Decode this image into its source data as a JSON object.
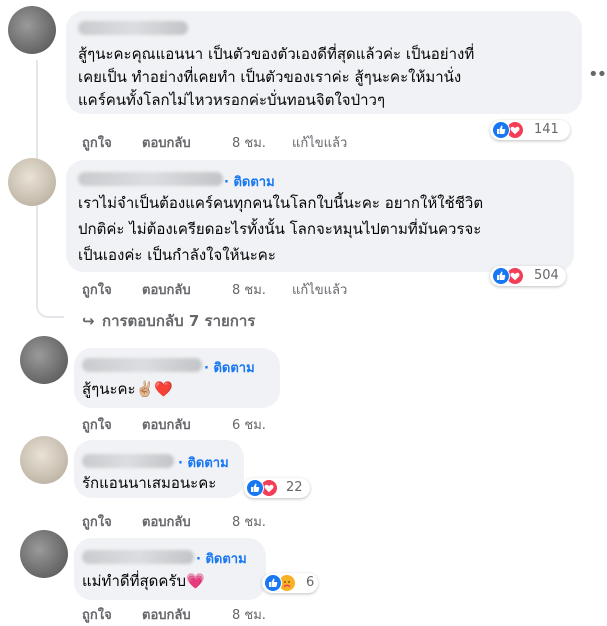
{
  "comments": [
    {
      "follow_label": "",
      "lines": [
        "สู้ๆนะคะคุณแอนนา เป็นตัวของตัวเองดีที่สุดแล้วค่ะ เป็นอย่างที่",
        "เคยเป็น ทำอย่างที่เคยทำ เป็นตัวของเราค่ะ สู้ๆนะคะให้มานั่ง",
        "แคร์คนทั้งโลกไม่ไหวหรอกค่ะบั่นทอนจิตใจป่าวๆ"
      ],
      "actions": {
        "like": "ถูกใจ",
        "reply": "ตอบกลับ",
        "time": "8 ชม.",
        "edited": "แก้ไขแล้ว"
      },
      "reactions": {
        "icons": [
          "like",
          "love"
        ],
        "count": "141"
      },
      "more_icon": "more-icon"
    },
    {
      "follow_label": "ติดตาม",
      "lines": [
        "เราไม่จำเป็นต้องแคร์คนทุกคนในโลกใบนี้นะคะ อยากให้ใช้ชีวิต",
        "ปกติค่ะ ไม่ต้องเครียดอะไรทั้งนั้น โลกจะหมุนไปตามที่มันควรจะ",
        "เป็นเองค่ะ เป็นกำลังใจให้นะคะ"
      ],
      "actions": {
        "like": "ถูกใจ",
        "reply": "ตอบกลับ",
        "time": "8 ชม.",
        "edited": "แก้ไขแล้ว"
      },
      "reactions": {
        "icons": [
          "like",
          "love"
        ],
        "count": "504"
      }
    },
    {
      "follow_label": "ติดตาม",
      "lines": [
        "สู้ๆนะคะ✌🏼❤️"
      ],
      "actions": {
        "like": "ถูกใจ",
        "reply": "ตอบกลับ",
        "time": "6 ชม."
      }
    },
    {
      "follow_label": "ติดตาม",
      "lines": [
        "รักแอนนาเสมอนะคะ"
      ],
      "actions": {
        "like": "ถูกใจ",
        "reply": "ตอบกลับ",
        "time": "8 ชม."
      },
      "reactions": {
        "icons": [
          "like",
          "love"
        ],
        "count": "22"
      }
    },
    {
      "follow_label": "ติดตาม",
      "lines": [
        "แม่ทำดีที่สุดครับ💗"
      ],
      "actions": {
        "like": "ถูกใจ",
        "reply": "ตอบกลับ",
        "time": "8 ชม."
      },
      "reactions": {
        "icons": [
          "like",
          "care"
        ],
        "count": "6"
      }
    }
  ],
  "replies_link": {
    "icon": "reply-arrow-icon",
    "label": "การตอบกลับ 7 รายการ"
  },
  "colors": {
    "link": "#1877f2",
    "secondary_text": "#65676b",
    "bubble": "#f0f2f5",
    "like": "#1877f2",
    "love": "#f33e58",
    "care": "#f7b125"
  }
}
